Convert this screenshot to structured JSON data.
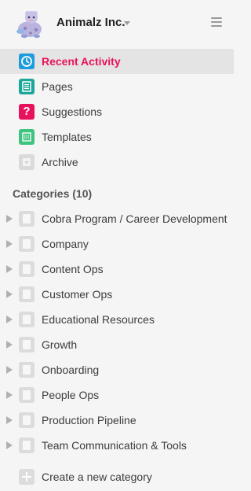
{
  "header": {
    "org_name": "Animalz Inc.",
    "logo_icon": "animal-mascot-icon",
    "menu_icon": "hamburger-icon"
  },
  "nav": {
    "items": [
      {
        "label": "Recent Activity",
        "icon": "clock-icon",
        "color": "#1e9bdc",
        "active": true
      },
      {
        "label": "Pages",
        "icon": "document-icon",
        "color": "#1ba89a"
      },
      {
        "label": "Suggestions",
        "icon": "question-icon",
        "color": "#e8125c",
        "glyph": "?"
      },
      {
        "label": "Templates",
        "icon": "template-icon",
        "color": "#3dc47e"
      },
      {
        "label": "Archive",
        "icon": "archive-icon",
        "color": "#dadada"
      }
    ],
    "active_color": "#e8125c"
  },
  "categories": {
    "heading": "Categories (10)",
    "items": [
      {
        "label": "Cobra Program / Career Development"
      },
      {
        "label": "Company"
      },
      {
        "label": "Content Ops"
      },
      {
        "label": "Customer Ops"
      },
      {
        "label": "Educational Resources"
      },
      {
        "label": "Growth"
      },
      {
        "label": "Onboarding"
      },
      {
        "label": "People Ops"
      },
      {
        "label": "Production Pipeline"
      },
      {
        "label": "Team Communication & Tools"
      }
    ],
    "create_label": "Create a new category"
  }
}
